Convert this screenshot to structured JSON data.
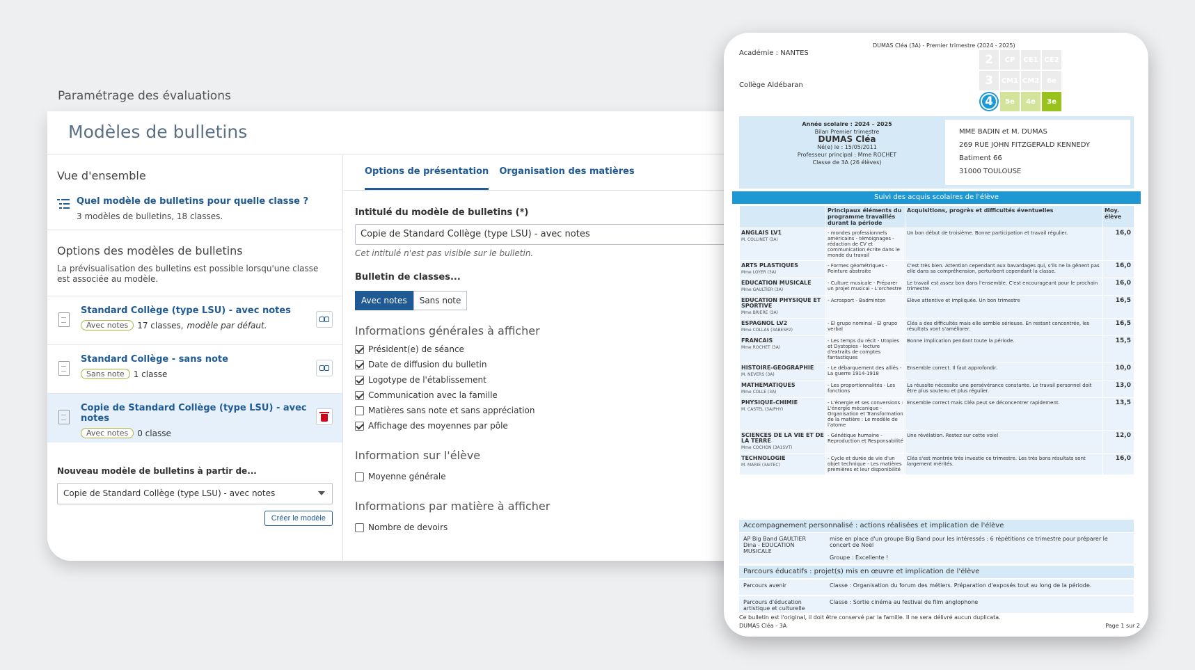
{
  "page": {
    "section_title": "Paramétrage des évaluations",
    "title": "Modèles de bulletins"
  },
  "left": {
    "overview_title": "Vue d'ensemble",
    "overview_link": "Quel modèle de bulletins pour quelle classe ?",
    "overview_sub": "3 modèles de bulletins, 18 classes.",
    "options_title": "Options des modèles de bulletins",
    "options_desc": "La prévisualisation des bulletins est possible lorsqu'une classe est associée au modèle.",
    "models": [
      {
        "name": "Standard Collège (type LSU) - avec notes",
        "badge": "Avec notes",
        "count": "17 classes,",
        "extra": "modèle par défaut."
      },
      {
        "name": "Standard Collège - sans note",
        "badge": "Sans note",
        "count": "1 classe",
        "extra": ""
      },
      {
        "name": "Copie de Standard Collège (type LSU) - avec notes",
        "badge": "Avec notes",
        "count": "0 classe",
        "extra": ""
      }
    ],
    "new_label": "Nouveau modèle de bulletins à partir de...",
    "new_select": "Copie de Standard Collège (type LSU) - avec notes",
    "create_button": "Créer le modèle"
  },
  "right": {
    "tabs": [
      "Options de présentation",
      "Organisation des matières"
    ],
    "name_label": "Intitulé du modèle de bulletins (*)",
    "name_value": "Copie de Standard Collège (type LSU) - avec notes",
    "name_hint": "Cet intitulé n'est pas visible sur le bulletin.",
    "bulletin_label": "Bulletin de classes...",
    "seg_on": "Avec notes",
    "seg_off": "Sans note",
    "general_title": "Informations générales à afficher",
    "general_items": [
      {
        "label": "Président(e) de séance",
        "checked": true
      },
      {
        "label": "Date de diffusion du bulletin",
        "checked": true
      },
      {
        "label": "Logotype de l'établissement",
        "checked": true
      },
      {
        "label": "Communication avec la famille",
        "checked": true
      },
      {
        "label": "Matières sans note et sans appréciation",
        "checked": false
      },
      {
        "label": "Affichage des moyennes par pôle",
        "checked": true
      }
    ],
    "student_title": "Information sur l'élève",
    "student_item": "Moyenne générale",
    "subject_title": "Informations par matière à afficher",
    "subject_item": "Nombre de devoirs"
  },
  "report": {
    "header": "DUMAS Cléa (3A) - Premier trimestre (2024 - 2025)",
    "academy": "Académie : NANTES",
    "college": "Collège Aldébaran",
    "cycle_grid": [
      "2",
      "CP",
      "CE1",
      "CE2",
      "3",
      "CM1",
      "CM2",
      "6e",
      "4",
      "5e",
      "4e",
      "3e"
    ],
    "year": "Année scolaire : 2024 – 2025",
    "period": "Bilan Premier trimestre",
    "student": "DUMAS Cléa",
    "born": "Né(e) le : 15/05/2011",
    "prof": "Professeur principal : Mme ROCHET",
    "class": "Classe de 3A (26 élèves)",
    "address": [
      "MME BADIN et M. DUMAS",
      "269 RUE JOHN FITZGERALD KENNEDY",
      "Batiment 66",
      "31000 TOULOUSE"
    ],
    "banner": "Suivi des acquis scolaires de l'élève",
    "col_program": "Principaux éléments du programme travaillés durant la période",
    "col_acq": "Acquisitions, progrès et difficultés éventuelles",
    "col_avg": "Moy. élève",
    "rows": [
      {
        "subject": "ANGLAIS LV1",
        "teacher": "M. COLLINET (3A)",
        "program": "- mondes professionnels américains - témoignages - rédaction de CV et communication écrite dans le monde du travail",
        "comment": "Un bon début de troisième. Bonne participation et travail régulier.",
        "avg": "16,0"
      },
      {
        "subject": "ARTS PLASTIQUES",
        "teacher": "Mme LOYER (3A)",
        "program": "- Formes géométriques - Peinture abstraite",
        "comment": "C'est très bien. Attention cependant aux bavardages qui, s'ils ne la gênent pas elle dans sa compréhension, perturbent cependant la classe.",
        "avg": "16,0"
      },
      {
        "subject": "EDUCATION MUSICALE",
        "teacher": "Mme GAULTIER (3A)",
        "program": "- Culture musicale - Préparer un projet musical - L'orchestre",
        "comment": "Le travail est assez bon dans l'ensemble. C'est encourageant pour le prochain trimestre.",
        "avg": "16,0"
      },
      {
        "subject": "EDUCATION PHYSIQUE ET SPORTIVE",
        "teacher": "Mme BRIERE (3A)",
        "program": "- Acrosport - Badminton",
        "comment": "Elève attentive et impliquée. Un bon trimestre",
        "avg": "16,5"
      },
      {
        "subject": "ESPAGNOL LV2",
        "teacher": "Mme COLLAS (3ABESP2)",
        "program": "- El grupo nominal - El grupo verbal",
        "comment": "Cléa a des difficultés mais elle semble sérieuse. En restant concentrée, les résultats vont s'améliorer.",
        "avg": "16,5"
      },
      {
        "subject": "FRANCAIS",
        "teacher": "Mme ROCHET (3A)",
        "program": "- Les temps du récit - Utopies et Dystopies - lecture d'extraits de comptes fantastiques",
        "comment": "Bonne implication pendant toute la période.",
        "avg": "15,5"
      },
      {
        "subject": "HISTOIRE-GEOGRAPHIE",
        "teacher": "M. NEVERS (3A)",
        "program": "- Le débarquement des alliés - La guerre 1914-1918",
        "comment": "Ensemble correct. Il faut approfondir.",
        "avg": "10,0"
      },
      {
        "subject": "MATHEMATIQUES",
        "teacher": "Mme COLLE (3A)",
        "program": "- Les proportionnalités - Les fonctions",
        "comment": "La réussite nécessite une persévérance constante. Le travail personnel doit être plus soutenu et plus régulier.",
        "avg": "13,0"
      },
      {
        "subject": "PHYSIQUE-CHIMIE",
        "teacher": "M. CASTEL (3A/PHY)",
        "program": "- L'énergie et ses conversions : L'énergie mécanique - Organisation et Transformation de la matière : Le modèle de l'atome",
        "comment": "Ensemble correct mais Cléa peut se déconcentrer rapidement.",
        "avg": "13,5"
      },
      {
        "subject": "SCIENCES DE LA VIE ET DE LA TERRE",
        "teacher": "Mme COCHON (3A1SVT)",
        "program": "- Génétique humaine - Reproduction et Responsabilité",
        "comment": "Une révélation. Restez sur cette voie!",
        "avg": "12,0"
      },
      {
        "subject": "TECHNOLOGIE",
        "teacher": "M. MARIE (3AITEC)",
        "program": "- Cycle et durée de vie d'un objet technique - Les matières premières et leur disponibilité",
        "comment": "Cléa s'est montrée très investie ce trimestre. Les très bons résultats sont largement mérités.",
        "avg": "16,0"
      }
    ],
    "ap_title": "Accompagnement personnalisé : actions réalisées et implication de l'élève",
    "ap_key": "AP Big Band GAULTIER Dina - EDUCATION MUSICALE",
    "ap_value": "mise en place d'un groupe Big Band pour les intéressés : 6 répétitions ce trimestre pour préparer le concert de Noël",
    "ap_group": "Groupe : Excellente !",
    "pe_title": "Parcours éducatifs : projet(s) mis en œuvre et implication de l'élève",
    "pe_rows": [
      {
        "key": "Parcours avenir",
        "value": "Classe : Organisation du forum des métiers. Préparation d'exposés tout au long de la période."
      },
      {
        "key": "Parcours d'éducation artistique et culturelle",
        "value": "Classe : Sortie cinéma au festival de film anglophone"
      }
    ],
    "footer_note": "Ce bulletin est l'original, il doit être conservé par la famille. Il ne sera délivré aucun duplicata.",
    "footer_name": "DUMAS Cléa - 3A",
    "footer_page": "Page 1 sur 2"
  }
}
